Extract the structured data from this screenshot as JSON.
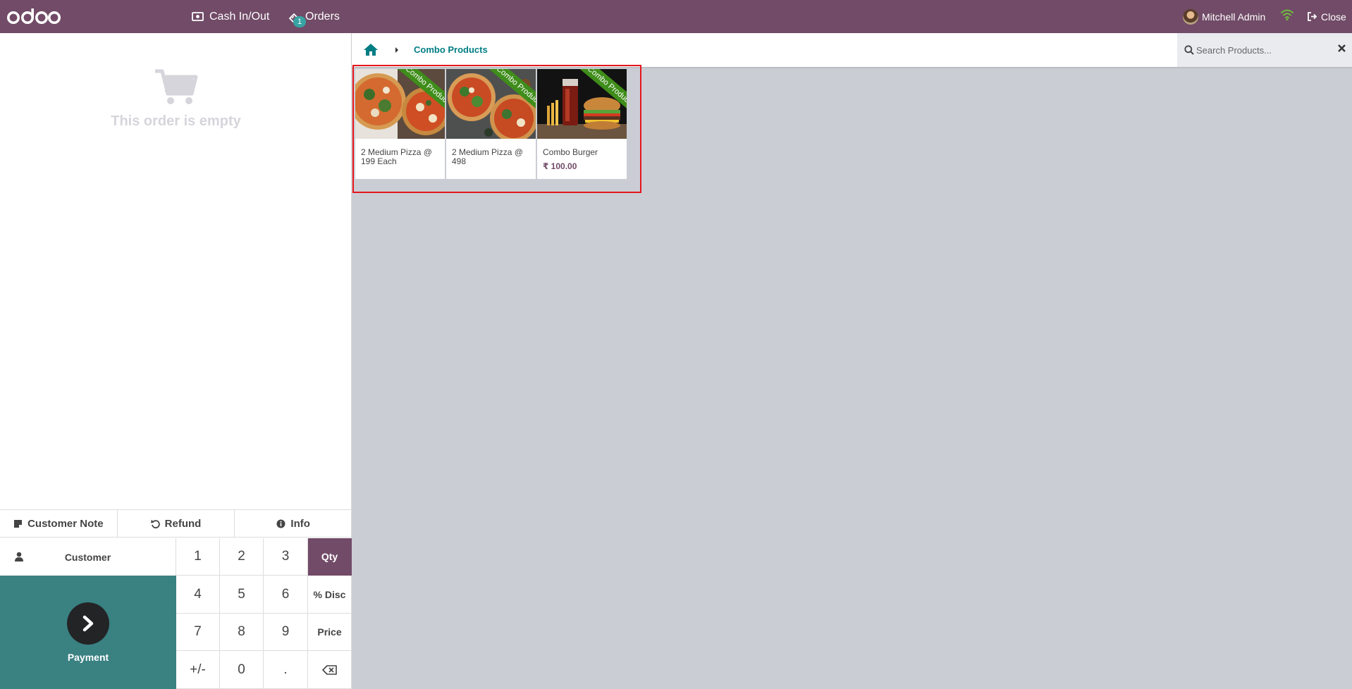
{
  "navbar": {
    "cash_label": "Cash In/Out",
    "orders_label": "Orders",
    "orders_badge": "1",
    "user_name": "Mitchell Admin",
    "close_label": "Close",
    "brand_color": "#714B67"
  },
  "order": {
    "empty_text": "This order is empty"
  },
  "controls": {
    "customer_note": "Customer Note",
    "refund": "Refund",
    "info": "Info",
    "customer": "Customer",
    "payment": "Payment"
  },
  "numpad": {
    "keys": [
      "1",
      "2",
      "3",
      "Qty",
      "4",
      "5",
      "6",
      "% Disc",
      "7",
      "8",
      "9",
      "Price",
      "+/-",
      "0",
      "."
    ],
    "active_mode": "Qty"
  },
  "breadcrumb": {
    "current": "Combo Products"
  },
  "search": {
    "placeholder": "Search Products..."
  },
  "products": [
    {
      "name": "2 Medium Pizza @ 199 Each",
      "price": "",
      "ribbon": "Combo Product"
    },
    {
      "name": "2 Medium Pizza @ 498",
      "price": "",
      "ribbon": "Combo Product"
    },
    {
      "name": "Combo Burger",
      "price": "₹ 100.00",
      "ribbon": "Combo Product"
    }
  ]
}
